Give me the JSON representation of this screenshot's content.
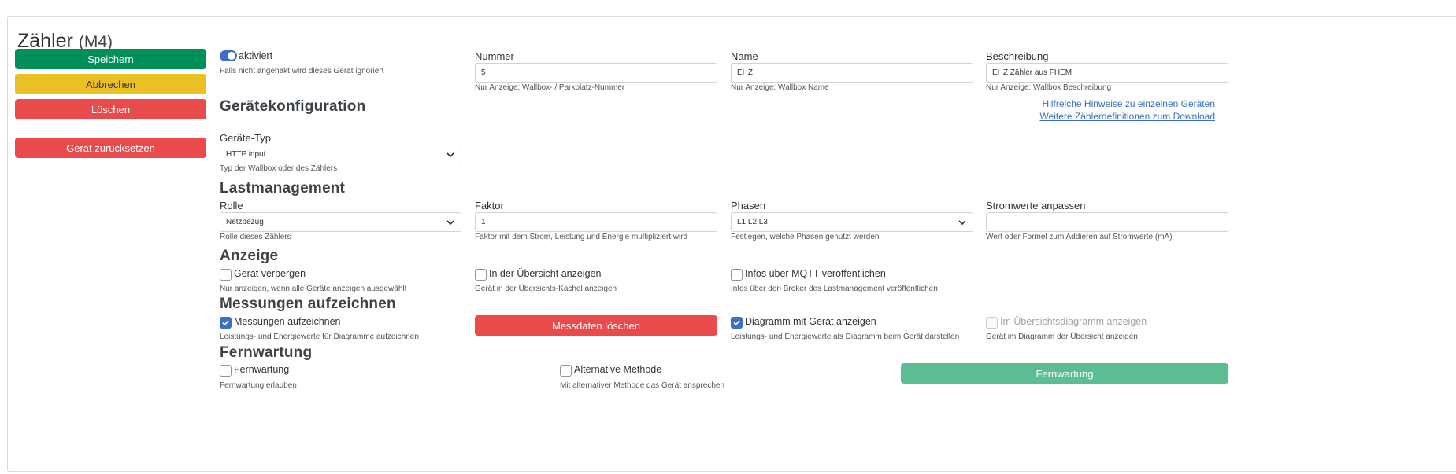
{
  "header": {
    "title": "Zähler",
    "subtitle": "(M4)"
  },
  "sidebar": {
    "save_label": "Speichern",
    "cancel_label": "Abbrechen",
    "delete_label": "Löschen",
    "reset_label": "Gerät zurücksetzen"
  },
  "general": {
    "enabled_label": "aktiviert",
    "enabled_help": "Falls nicht angehakt wird dieses Gerät ignoriert",
    "number_label": "Nummer",
    "number_value": "5",
    "number_help": "Nur Anzeige: Wallbox- / Parkplatz-Nummer",
    "name_label": "Name",
    "name_value": "EHZ",
    "name_help": "Nur Anzeige: Wallbox Name",
    "desc_label": "Beschreibung",
    "desc_value": "EHZ Zähler aus FHEM",
    "desc_help": "Nur Anzeige: Wallbox Beschreibung"
  },
  "device_config": {
    "heading": "Gerätekonfiguration",
    "link_hints": "Hilfreiche Hinweise zu einzelnen Geräten",
    "link_downloads": "Weitere Zählerdefinitionen zum Download",
    "type_label": "Geräte-Typ",
    "type_value": "HTTP input",
    "type_help": "Typ der Wallbox oder des Zählers"
  },
  "load_management": {
    "heading": "Lastmanagement",
    "role_label": "Rolle",
    "role_value": "Netzbezug",
    "role_help": "Rolle dieses Zählers",
    "factor_label": "Faktor",
    "factor_value": "1",
    "factor_help": "Faktor mit dem Strom, Leistung und Energie multipliziert wird",
    "phases_label": "Phasen",
    "phases_value": "L1,L2,L3",
    "phases_help": "Festlegen, welche Phasen genutzt werden",
    "current_label": "Stromwerte anpassen",
    "current_value": "",
    "current_help": "Wert oder Formel zum Addieren auf Stromwerte (mA)"
  },
  "display": {
    "heading": "Anzeige",
    "hide_label": "Gerät verbergen",
    "hide_help": "Nur anzeigen, wenn alle Geräte anzeigen ausgewählt",
    "overview_label": "In der Übersicht anzeigen",
    "overview_help": "Gerät in der Übersichts-Kachel anzeigen",
    "mqtt_label": "Infos über MQTT veröffentlichen",
    "mqtt_help": "Infos über den Broker des Lastmanagement veröffentlichen"
  },
  "recording": {
    "heading": "Messungen aufzeichnen",
    "record_label": "Messungen aufzeichnen",
    "record_help": "Leistungs- und Energiewerte für Diagramme aufzeichnen",
    "delete_data_label": "Messdaten löschen",
    "chart_label": "Diagramm mit Gerät anzeigen",
    "chart_help": "Leistungs- und Energiewerte als Diagramm beim Gerät darstellen",
    "overview_chart_label": "Im Übersichtsdiagramm anzeigen",
    "overview_chart_help": "Gerät im Diagramm der Übersicht anzeigen"
  },
  "remote": {
    "heading": "Fernwartung",
    "remote_label": "Fernwartung",
    "remote_help": "Fernwartung erlauben",
    "alt_label": "Alternative Methode",
    "alt_help": "Mit alternativer Methode das Gerät ansprechen",
    "button_label": "Fernwartung"
  },
  "colors": {
    "save": "#008f5a",
    "cancel": "#ebc024",
    "danger": "#e94a4b",
    "remote": "#5bbd92",
    "accent": "#3d6fc2"
  },
  "icons": {
    "select": "chevron-down-icon",
    "checked": "check-icon"
  }
}
